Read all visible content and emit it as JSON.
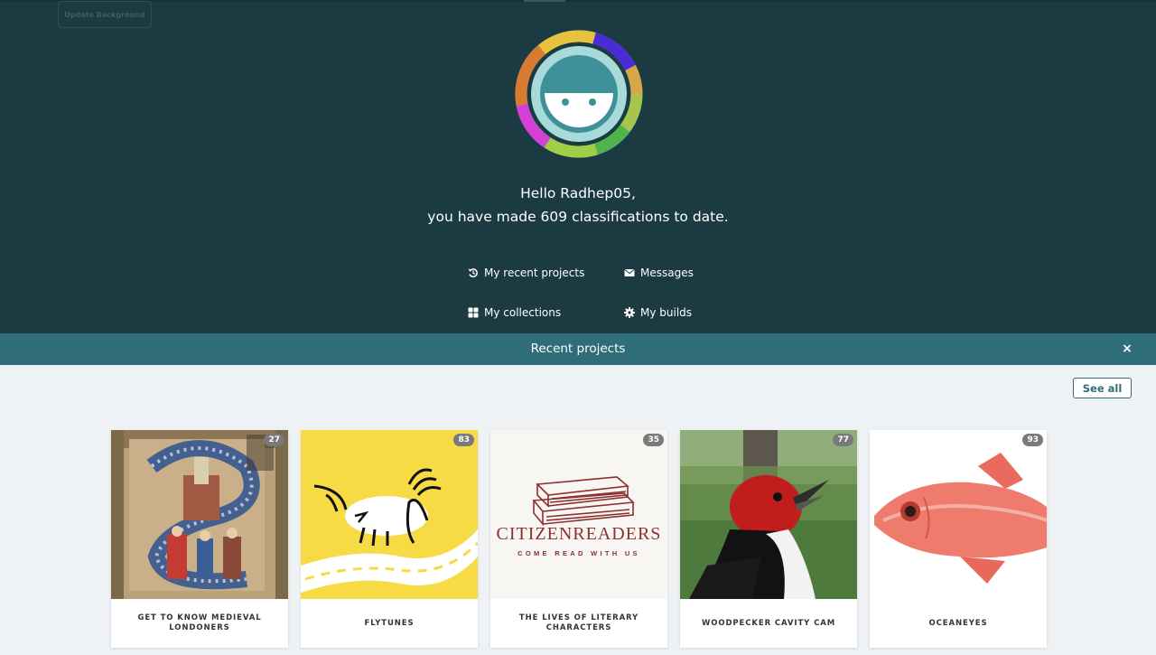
{
  "header": {
    "update_background_label": "Update Background",
    "greeting_line1": "Hello Radhep05,",
    "greeting_line2": "you have made 609 classifications to date."
  },
  "nav": {
    "recent_projects": "My recent projects",
    "messages": "Messages",
    "collections": "My collections",
    "builds": "My builds"
  },
  "recent_bar": {
    "title": "Recent projects",
    "close_icon": "×"
  },
  "see_all_label": "See all",
  "projects": [
    {
      "title": "GET TO KNOW MEDIEVAL LONDONERS",
      "count": "27",
      "image": "illuminated-manuscript"
    },
    {
      "title": "FLYTUNES",
      "count": "83",
      "image": "fly-drawing"
    },
    {
      "title": "THE LIVES OF LITERARY CHARACTERS",
      "count": "35",
      "image": "citizenreaders-logo"
    },
    {
      "title": "WOODPECKER CAVITY CAM",
      "count": "77",
      "image": "red-headed-woodpecker"
    },
    {
      "title": "OCEANEYES",
      "count": "93",
      "image": "red-fish"
    }
  ],
  "colors": {
    "hero_bg": "#1b3a42",
    "bar_bg": "#2f6d78",
    "page_bg": "#eff2f5"
  }
}
